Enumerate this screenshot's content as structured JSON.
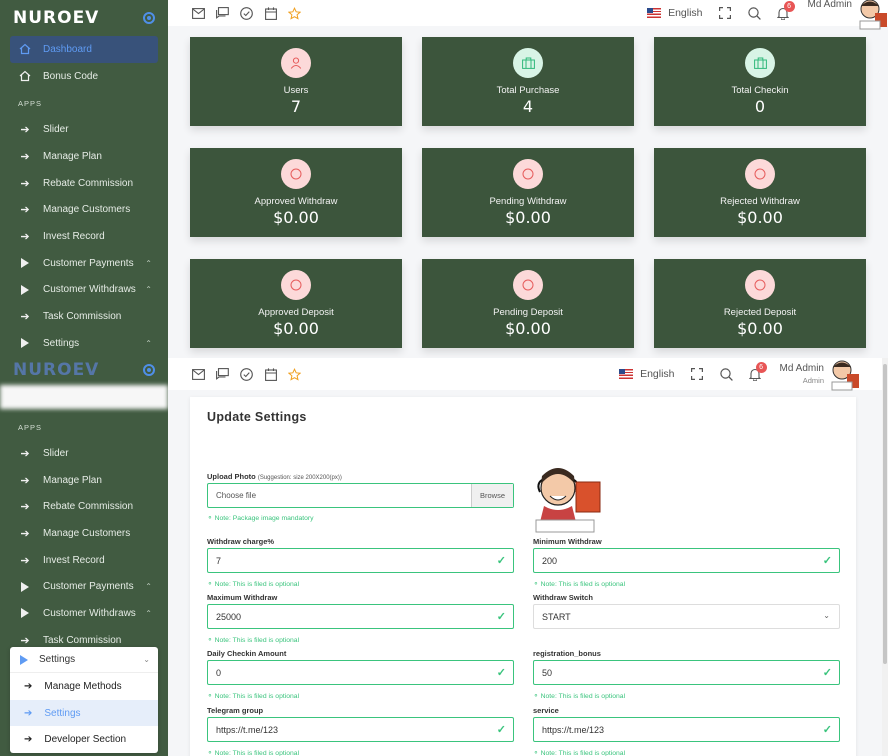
{
  "brand": {
    "name": "NUROEV"
  },
  "sidebar_top": {
    "items": [
      {
        "label": "Dashboard"
      },
      {
        "label": "Bonus Code"
      }
    ],
    "section": "APPS",
    "apps": [
      {
        "label": "Slider"
      },
      {
        "label": "Manage Plan"
      },
      {
        "label": "Rebate Commission"
      },
      {
        "label": "Manage Customers"
      },
      {
        "label": "Invest Record"
      },
      {
        "label": "Customer Payments"
      },
      {
        "label": "Customer Withdraws"
      },
      {
        "label": "Task Commission"
      },
      {
        "label": "Settings"
      }
    ]
  },
  "sidebar_bottom": {
    "section": "APPS",
    "apps": [
      {
        "label": "Slider"
      },
      {
        "label": "Manage Plan"
      },
      {
        "label": "Rebate Commission"
      },
      {
        "label": "Manage Customers"
      },
      {
        "label": "Invest Record"
      },
      {
        "label": "Customer Payments"
      },
      {
        "label": "Customer Withdraws"
      },
      {
        "label": "Task Commission"
      }
    ],
    "settings_panel": {
      "title": "Settings",
      "items": [
        {
          "label": "Manage Methods"
        },
        {
          "label": "Settings"
        },
        {
          "label": "Developer Section"
        }
      ]
    }
  },
  "topbar": {
    "language": "English",
    "notifications": "6",
    "user_name": "Md Admin",
    "user_role": "Admin"
  },
  "stats": [
    {
      "label": "Users",
      "value": "7"
    },
    {
      "label": "Total Purchase",
      "value": "4"
    },
    {
      "label": "Total Checkin",
      "value": "0"
    },
    {
      "label": "Approved Withdraw",
      "value": "$0.00"
    },
    {
      "label": "Pending Withdraw",
      "value": "$0.00"
    },
    {
      "label": "Rejected Withdraw",
      "value": "$0.00"
    },
    {
      "label": "Approved Deposit",
      "value": "$0.00"
    },
    {
      "label": "Pending Deposit",
      "value": "$0.00"
    },
    {
      "label": "Rejected Deposit",
      "value": "$0.00"
    }
  ],
  "form": {
    "title": "Update Settings",
    "upload_label": "Upload Photo",
    "upload_hint": "(Suggestion: size 200X200(px))",
    "upload_placeholder": "Choose file",
    "browse": "Browse",
    "upload_note": "Note: Package image mandatory",
    "optional_note": "Note: This is filed is optional",
    "fields": {
      "withdraw_charge": {
        "label": "Withdraw charge%",
        "value": "7"
      },
      "minimum_withdraw": {
        "label": "Minimum Withdraw",
        "value": "200"
      },
      "maximum_withdraw": {
        "label": "Maximum Withdraw",
        "value": "25000"
      },
      "withdraw_switch": {
        "label": "Withdraw Switch",
        "value": "START"
      },
      "daily_checkin": {
        "label": "Daily Checkin Amount",
        "value": "0"
      },
      "registration_bonus": {
        "label": "registration_bonus",
        "value": "50"
      },
      "telegram_group": {
        "label": "Telegram group",
        "value": "https://t.me/123"
      },
      "service": {
        "label": "service",
        "value": "https://t.me/123"
      }
    }
  },
  "icons": {
    "dashboard": "home-icon",
    "bonus": "gift-icon",
    "arrow": "arrow-right-icon",
    "play": "play-icon",
    "mail": "mail-icon",
    "chat": "chat-icon",
    "check": "check-circle-icon",
    "calendar": "calendar-icon",
    "star": "star-icon",
    "flag": "us-flag-icon",
    "fullscreen": "fullscreen-icon",
    "search": "search-icon",
    "bell": "bell-icon"
  },
  "colors": {
    "sidebar": "#415b41",
    "card": "#3c553c",
    "accent": "#5f9bf3",
    "success": "#3ac47d",
    "badge": "#e85555"
  }
}
